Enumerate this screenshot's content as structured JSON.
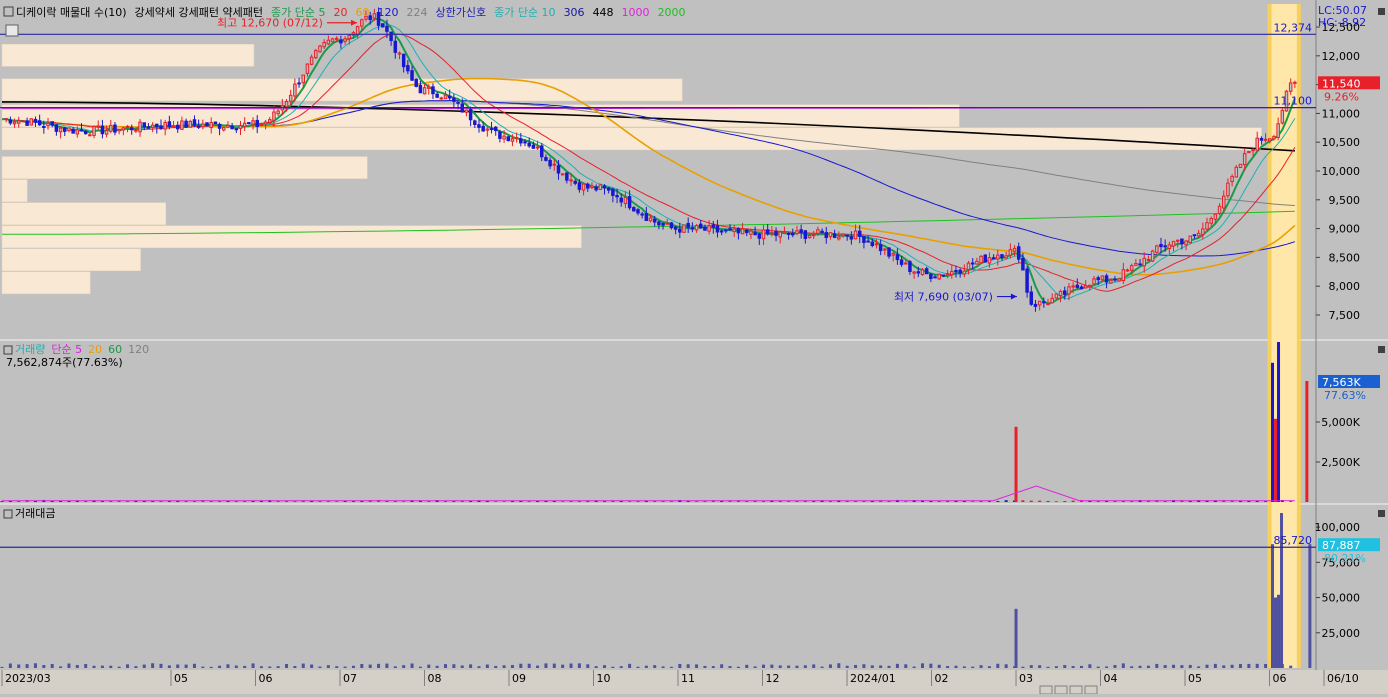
{
  "legend": {
    "main": [
      {
        "text": "디케이락 매물대 수(10)",
        "color": "#000000"
      },
      {
        "text": "강세약세 강세패턴  약세패턴",
        "color": "#000000"
      },
      {
        "text": "종가 단순 5",
        "color": "#1a9a4a"
      },
      {
        "text": "20",
        "color": "#e8202a"
      },
      {
        "text": "60",
        "color": "#e8a000"
      },
      {
        "text": "120",
        "color": "#1818d0"
      },
      {
        "text": "224",
        "color": "#808080"
      },
      {
        "text": "상한가신호",
        "color": "#2020b0"
      },
      {
        "text": "종가 단순 10",
        "color": "#20b0b0"
      },
      {
        "text": "306",
        "color": "#1818a0"
      },
      {
        "text": "448",
        "color": "#000000"
      },
      {
        "text": "1000",
        "color": "#e020e0"
      },
      {
        "text": "2000",
        "color": "#20c020"
      }
    ],
    "volume": [
      {
        "text": "거래량",
        "color": "#20b0b0"
      },
      {
        "text": "단순 5",
        "color": "#e020e0"
      },
      {
        "text": "20",
        "color": "#e8a000"
      },
      {
        "text": "60",
        "color": "#1a9a4a"
      },
      {
        "text": "120",
        "color": "#808080"
      }
    ],
    "volume_value": "7,562,874주(77.63%)",
    "amount": [
      {
        "text": "거래대금",
        "color": "#000000"
      }
    ]
  },
  "corner": {
    "lc": "LC:50.07",
    "hc": "HC:-8.92"
  },
  "annotations": {
    "high": "최고 12,670 (07/12)",
    "low": "최저 7,690 (03/07)",
    "line_12374": "12,374",
    "line_11100": "11,100",
    "amount_line": "85,720"
  },
  "badges": {
    "price": "11,540",
    "price_pct": "9.26%",
    "volume": "7,563K",
    "volume_pct": "77.63%",
    "amount": "87,887",
    "amount_pct": "80.21%"
  },
  "colors": {
    "up": "#e8202a",
    "down": "#1818d0",
    "ma5": "#1a9a4a",
    "ma10": "#20b0b0",
    "ma20": "#e8202a",
    "ma60": "#e8a000",
    "ma120": "#1818d0",
    "ma224": "#808080",
    "ma448": "#000000",
    "ma1000": "#e020e0",
    "ma2000": "#20c020",
    "hline": "#2a2aa0",
    "profile": "#f8e8d4",
    "highlight": "#ffd24a",
    "price_badge": "#e8202a",
    "volume_badge": "#1a60d0",
    "amount_badge": "#20c0e0"
  },
  "chart_data": [
    {
      "type": "candlestick",
      "title": "디케이락 매물대 수(10)",
      "x_ticks": [
        "2023/03",
        "05",
        "06",
        "07",
        "08",
        "09",
        "10",
        "11",
        "12",
        "2024/01",
        "02",
        "03",
        "04",
        "05",
        "06",
        "06/10"
      ],
      "y_ticks": [
        "12,500",
        "12,000",
        "11,500",
        "11,000",
        "10,500",
        "10,000",
        "9,500",
        "9,000",
        "8,500",
        "8,000",
        "7,500"
      ],
      "ylim": [
        7100,
        12900
      ],
      "close_path": [
        {
          "date": "2023/03",
          "close": 10900
        },
        {
          "date": "2023/04",
          "close": 10700
        },
        {
          "date": "2023/05",
          "close": 10800
        },
        {
          "date": "2023/06",
          "close": 10800
        },
        {
          "date": "2023/07",
          "close": 12300
        },
        {
          "date": "2023/07/12",
          "close": 12670
        },
        {
          "date": "2023/08",
          "close": 11400
        },
        {
          "date": "2023/09",
          "close": 10600
        },
        {
          "date": "2023/10",
          "close": 9700
        },
        {
          "date": "2023/11",
          "close": 9000
        },
        {
          "date": "2023/12",
          "close": 8900
        },
        {
          "date": "2024/01",
          "close": 8900
        },
        {
          "date": "2024/02",
          "close": 8200
        },
        {
          "date": "2024/03/07",
          "close": 7690
        },
        {
          "date": "2024/03",
          "close": 8600
        },
        {
          "date": "2024/04",
          "close": 8100
        },
        {
          "date": "2024/05",
          "close": 8800
        },
        {
          "date": "2024/06",
          "close": 10600
        },
        {
          "date": "2024/06/10",
          "close": 11540
        }
      ],
      "horizontal_lines": [
        12374,
        11100
      ],
      "volume_profile_bins": [
        {
          "price_from": 11800,
          "price_to": 12200,
          "weight": 0.2
        },
        {
          "price_from": 11200,
          "price_to": 11600,
          "weight": 0.54
        },
        {
          "price_from": 10750,
          "price_to": 11150,
          "weight": 0.76
        },
        {
          "price_from": 10350,
          "price_to": 10750,
          "weight": 1.0
        },
        {
          "price_from": 9850,
          "price_to": 10250,
          "weight": 0.29
        },
        {
          "price_from": 9450,
          "price_to": 9850,
          "weight": 0.02
        },
        {
          "price_from": 9050,
          "price_to": 9450,
          "weight": 0.13
        },
        {
          "price_from": 8650,
          "price_to": 9050,
          "weight": 0.46
        },
        {
          "price_from": 8250,
          "price_to": 8650,
          "weight": 0.11
        },
        {
          "price_from": 7850,
          "price_to": 8250,
          "weight": 0.07
        }
      ]
    },
    {
      "type": "bar",
      "title": "거래량",
      "y_ticks": [
        "7,563K",
        "5,000K",
        "2,500K"
      ],
      "ylim": [
        0,
        10000
      ],
      "series": [
        {
          "name": "거래량",
          "spikes": [
            {
              "date": "2024/03",
              "value": 4700
            },
            {
              "date": "2024/06",
              "value": 8700
            },
            {
              "date": "2024/06",
              "value": 5200
            },
            {
              "date": "2024/06",
              "value": 10000
            },
            {
              "date": "2024/06/10",
              "value": 7563
            }
          ]
        }
      ]
    },
    {
      "type": "bar",
      "title": "거래대금",
      "y_ticks": [
        "100,000",
        "75,000",
        "50,000",
        "25,000"
      ],
      "ylim": [
        0,
        115000
      ],
      "series": [
        {
          "name": "거래대금",
          "spikes": [
            {
              "date": "2024/03",
              "value": 42000
            },
            {
              "date": "2024/06",
              "value": 87887
            },
            {
              "date": "2024/06",
              "value": 50000
            },
            {
              "date": "2024/06",
              "value": 52000
            },
            {
              "date": "2024/06",
              "value": 110000
            },
            {
              "date": "2024/06/10",
              "value": 87887
            }
          ]
        }
      ],
      "horizontal_lines": [
        85720
      ]
    }
  ]
}
